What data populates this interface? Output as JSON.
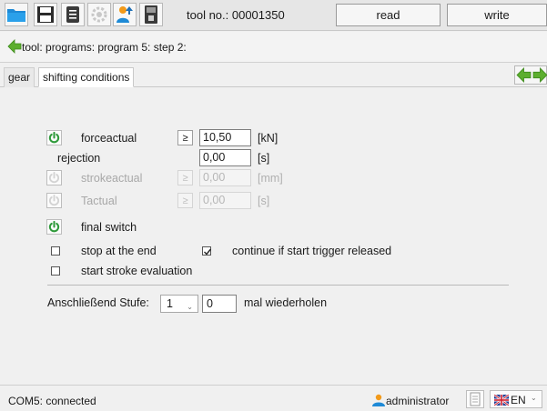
{
  "toolbar": {
    "tool_label": "tool no.: 00001350",
    "read_label": "read",
    "write_label": "write",
    "icons": [
      "folder-icon",
      "save-icon",
      "print-icon",
      "settings-icon",
      "user-upload-icon",
      "device-icon"
    ]
  },
  "breadcrumb": {
    "text": "tool: programs: program 5: step 2:"
  },
  "tabs": [
    {
      "label": "gear",
      "active": false
    },
    {
      "label": "shifting conditions",
      "active": true
    }
  ],
  "conditions": {
    "force": {
      "label": "forceactual",
      "operator": "≥",
      "value": "10,50",
      "unit": "[kN]",
      "enabled": true
    },
    "rejection": {
      "label": "rejection",
      "value": "0,00",
      "unit": "[s]"
    },
    "stroke": {
      "label": "strokeactual",
      "operator": "≥",
      "value": "0,00",
      "unit": "[mm]",
      "enabled": false
    },
    "t": {
      "label": "Tactual",
      "operator": "≥",
      "value": "0,00",
      "unit": "[s]",
      "enabled": false
    },
    "final_switch": {
      "label": "final switch",
      "enabled": true
    }
  },
  "options": {
    "stop_at_end": {
      "label": "stop at the end",
      "checked": false
    },
    "continue_if_released": {
      "label": "continue if start trigger released",
      "checked": true
    },
    "start_stroke_eval": {
      "label": "start stroke evaluation",
      "checked": false
    }
  },
  "repeat": {
    "prefix": "Anschließend Stufe:",
    "step_value": "1",
    "count_value": "0",
    "suffix": "mal wiederholen"
  },
  "status": {
    "connection": "COM5: connected",
    "user": "administrator",
    "language": "EN"
  },
  "colors": {
    "power_green": "#2e9a3a",
    "arrow_green": "#5cae2e",
    "folder_blue": "#1e8ad6"
  }
}
